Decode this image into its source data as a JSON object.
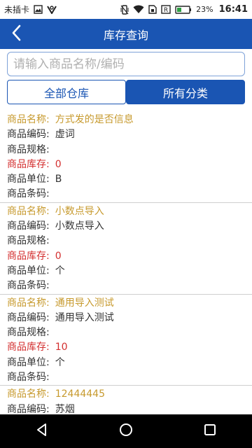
{
  "status": {
    "carrier": "未插卡",
    "battery_pct": "23%",
    "time": "16:41"
  },
  "header": {
    "title": "库存查询"
  },
  "search": {
    "placeholder": "请输入商品名称/编码"
  },
  "filters": {
    "warehouse": "全部仓库",
    "category": "所有分类"
  },
  "labels": {
    "name": "商品名称:",
    "code": "商品编码:",
    "spec": "商品规格:",
    "stock": "商品库存:",
    "unit": "商品单位:",
    "barcode": "商品条码:"
  },
  "items": [
    {
      "name": "方式发的是否信息",
      "code": "虚词",
      "spec": "",
      "stock": "0",
      "unit": "B",
      "barcode": ""
    },
    {
      "name": "小数点导入",
      "code": "小数点导入",
      "spec": "",
      "stock": "0",
      "unit": "个",
      "barcode": ""
    },
    {
      "name": "通用导入测试",
      "code": "通用导入测试",
      "spec": "",
      "stock": "10",
      "unit": "个",
      "barcode": ""
    },
    {
      "name": "12444445",
      "code": "苏烟",
      "spec": "",
      "stock": "",
      "unit": "",
      "barcode": ""
    }
  ],
  "colors": {
    "primary": "#1a55b3",
    "name_text": "#c79a2e",
    "stock_text": "#d32f2f"
  }
}
